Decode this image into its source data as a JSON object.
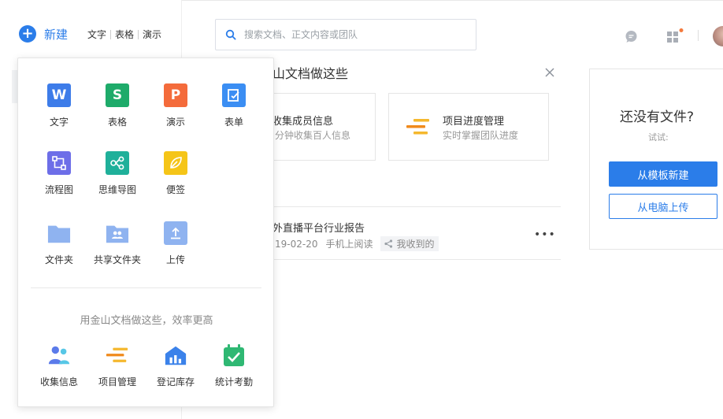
{
  "sidebar": {
    "new_label": "新建",
    "quick_links": [
      "文字",
      "表格",
      "演示"
    ]
  },
  "search": {
    "placeholder": "搜索文档、正文内容或团队"
  },
  "header_icons": [
    "chat-bubble-icon",
    "apps-grid-icon",
    "avatar"
  ],
  "main": {
    "section_title": "山文档做这些",
    "cards": [
      {
        "title": "收集成员信息",
        "subtitle": "分钟收集百人信息"
      },
      {
        "title": "项目进度管理",
        "subtitle": "实时掌握团队进度"
      }
    ],
    "file": {
      "title": "外直播平台行业报告",
      "date": "19-02-20",
      "source": "手机上阅读",
      "tag": "我收到的"
    }
  },
  "right_panel": {
    "title": "还没有文件?",
    "try_label": "试试:",
    "template_button": "从模板新建",
    "upload_button": "从电脑上传"
  },
  "popup": {
    "items": [
      {
        "label": "文字",
        "icon": "W",
        "color": "#3d7ce9"
      },
      {
        "label": "表格",
        "icon": "S",
        "color": "#1eab6a"
      },
      {
        "label": "演示",
        "icon": "P",
        "color": "#f46b3b"
      },
      {
        "label": "表单",
        "icon": "form",
        "color": "#3b8ef3"
      },
      {
        "label": "流程图",
        "icon": "flow",
        "color": "#6d6ee8"
      },
      {
        "label": "思维导图",
        "icon": "mind",
        "color": "#1fb09a"
      },
      {
        "label": "便签",
        "icon": "leaf",
        "color": "#f5c518"
      },
      {
        "label": "文件夹",
        "icon": "folder",
        "color": "#8fb3f0"
      },
      {
        "label": "共享文件夹",
        "icon": "shared-folder",
        "color": "#8fb3f0"
      },
      {
        "label": "上传",
        "icon": "upload",
        "color": "#8fb3f0"
      }
    ],
    "tagline": "用金山文档做这些，效率更高",
    "templates": [
      {
        "label": "收集信息",
        "icon": "people-icon"
      },
      {
        "label": "项目管理",
        "icon": "bars-icon"
      },
      {
        "label": "登记库存",
        "icon": "warehouse-icon"
      },
      {
        "label": "统计考勤",
        "icon": "calendar-check-icon"
      }
    ]
  }
}
